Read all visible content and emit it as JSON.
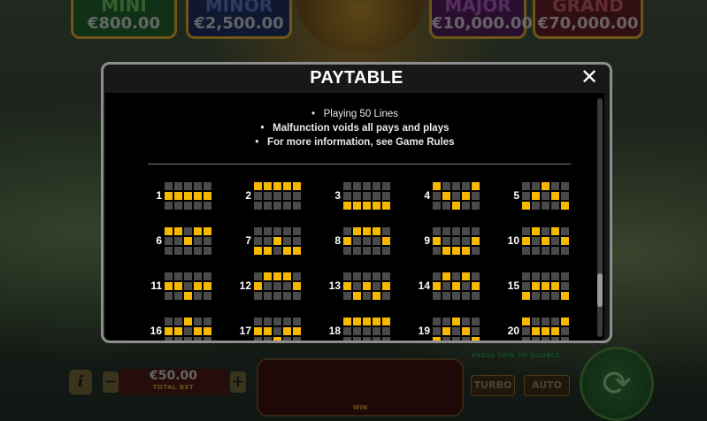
{
  "jackpots": [
    {
      "name": "MINI",
      "value": "€800.00"
    },
    {
      "name": "MINOR",
      "value": "€2,500.00"
    },
    {
      "name": "MAJOR",
      "value": "€10,000.00"
    },
    {
      "name": "GRAND",
      "value": "€70,000.00"
    }
  ],
  "bottom_bar": {
    "info_label": "i",
    "minus_label": "−",
    "plus_label": "+",
    "bet_value": "€50.00",
    "bet_label": "TOTAL BET",
    "win_label": "WIN",
    "double_label": "PRESS SPIN TO DOUBLE",
    "turbo_label": "TURBO",
    "auto_label": "AUTO"
  },
  "paytable": {
    "title": "PAYTABLE",
    "close_symbol": "✕",
    "notes": [
      "Playing 50 Lines",
      "Malfunction voids all pays and plays",
      "For more information, see Game Rules"
    ],
    "highlight_color": "#f7b800",
    "empty_color": "#4a4a4a",
    "paylines": [
      {
        "n": "1",
        "rows": [
          1,
          1,
          1,
          1,
          1
        ]
      },
      {
        "n": "2",
        "rows": [
          0,
          0,
          0,
          0,
          0
        ]
      },
      {
        "n": "3",
        "rows": [
          2,
          2,
          2,
          2,
          2
        ]
      },
      {
        "n": "4",
        "rows": [
          0,
          1,
          2,
          1,
          0
        ]
      },
      {
        "n": "5",
        "rows": [
          2,
          1,
          0,
          1,
          2
        ]
      },
      {
        "n": "6",
        "rows": [
          0,
          0,
          1,
          0,
          0
        ]
      },
      {
        "n": "7",
        "rows": [
          2,
          2,
          1,
          2,
          2
        ]
      },
      {
        "n": "8",
        "rows": [
          1,
          0,
          0,
          0,
          1
        ]
      },
      {
        "n": "9",
        "rows": [
          1,
          2,
          2,
          2,
          1
        ]
      },
      {
        "n": "10",
        "rows": [
          1,
          0,
          1,
          0,
          1
        ]
      },
      {
        "n": "11",
        "rows": [
          1,
          1,
          2,
          1,
          1
        ]
      },
      {
        "n": "12",
        "rows": [
          1,
          0,
          0,
          0,
          1
        ]
      },
      {
        "n": "13",
        "rows": [
          1,
          2,
          1,
          2,
          1
        ]
      },
      {
        "n": "14",
        "rows": [
          1,
          0,
          1,
          0,
          1
        ]
      },
      {
        "n": "15",
        "rows": [
          2,
          1,
          1,
          1,
          2
        ]
      },
      {
        "n": "16",
        "rows": [
          1,
          1,
          0,
          1,
          1
        ]
      },
      {
        "n": "17",
        "rows": [
          1,
          1,
          2,
          1,
          1
        ]
      },
      {
        "n": "18",
        "rows": [
          0,
          0,
          0,
          0,
          0
        ]
      },
      {
        "n": "19",
        "rows": [
          2,
          1,
          0,
          1,
          2
        ]
      },
      {
        "n": "20",
        "rows": [
          0,
          1,
          1,
          1,
          0
        ]
      }
    ]
  }
}
